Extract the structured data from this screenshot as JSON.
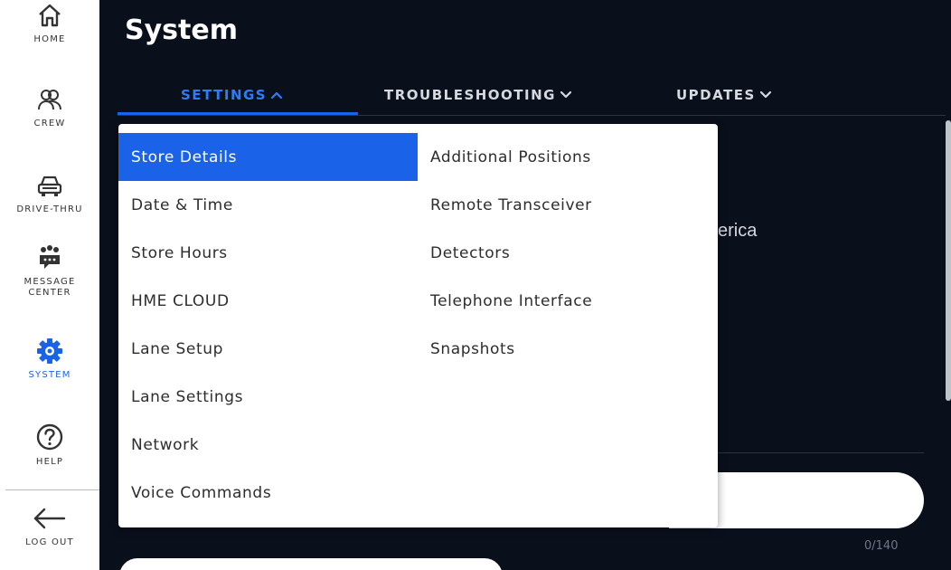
{
  "sidebar": {
    "items": [
      {
        "label": "HOME",
        "icon": "home-icon"
      },
      {
        "label": "CREW",
        "icon": "crew-icon"
      },
      {
        "label": "DRIVE-THRU",
        "icon": "car-icon"
      },
      {
        "label": "MESSAGE CENTER",
        "icon": "message-center-icon"
      },
      {
        "label": "SYSTEM",
        "icon": "gear-icon",
        "active": true
      },
      {
        "label": "HELP",
        "icon": "help-icon"
      },
      {
        "label": "LOG OUT",
        "icon": "arrow-left-icon"
      }
    ],
    "active_color": "#1a63e8"
  },
  "page": {
    "title": "System"
  },
  "tabs": [
    {
      "label": "SETTINGS",
      "active": true,
      "icon": "chevron-up-icon"
    },
    {
      "label": "TROUBLESHOOTING",
      "active": false,
      "icon": "chevron-down-icon"
    },
    {
      "label": "UPDATES",
      "active": false,
      "icon": "chevron-down-icon"
    }
  ],
  "dropdown": {
    "column1": [
      "Store Details",
      "Date & Time",
      "Store Hours",
      "HME CLOUD",
      "Lane Setup",
      "Lane Settings",
      "Network",
      "Voice Commands"
    ],
    "column2": [
      "Additional Positions",
      "Remote Transceiver",
      "Detectors",
      "Telephone Interface",
      "Snapshots"
    ],
    "selected": "Store Details"
  },
  "background": {
    "partial_text": "erica",
    "char_counter": "0/140"
  },
  "colors": {
    "accent": "#1a63e8",
    "main_bg": "#0a0f1c",
    "sidebar_bg": "#ffffff"
  }
}
